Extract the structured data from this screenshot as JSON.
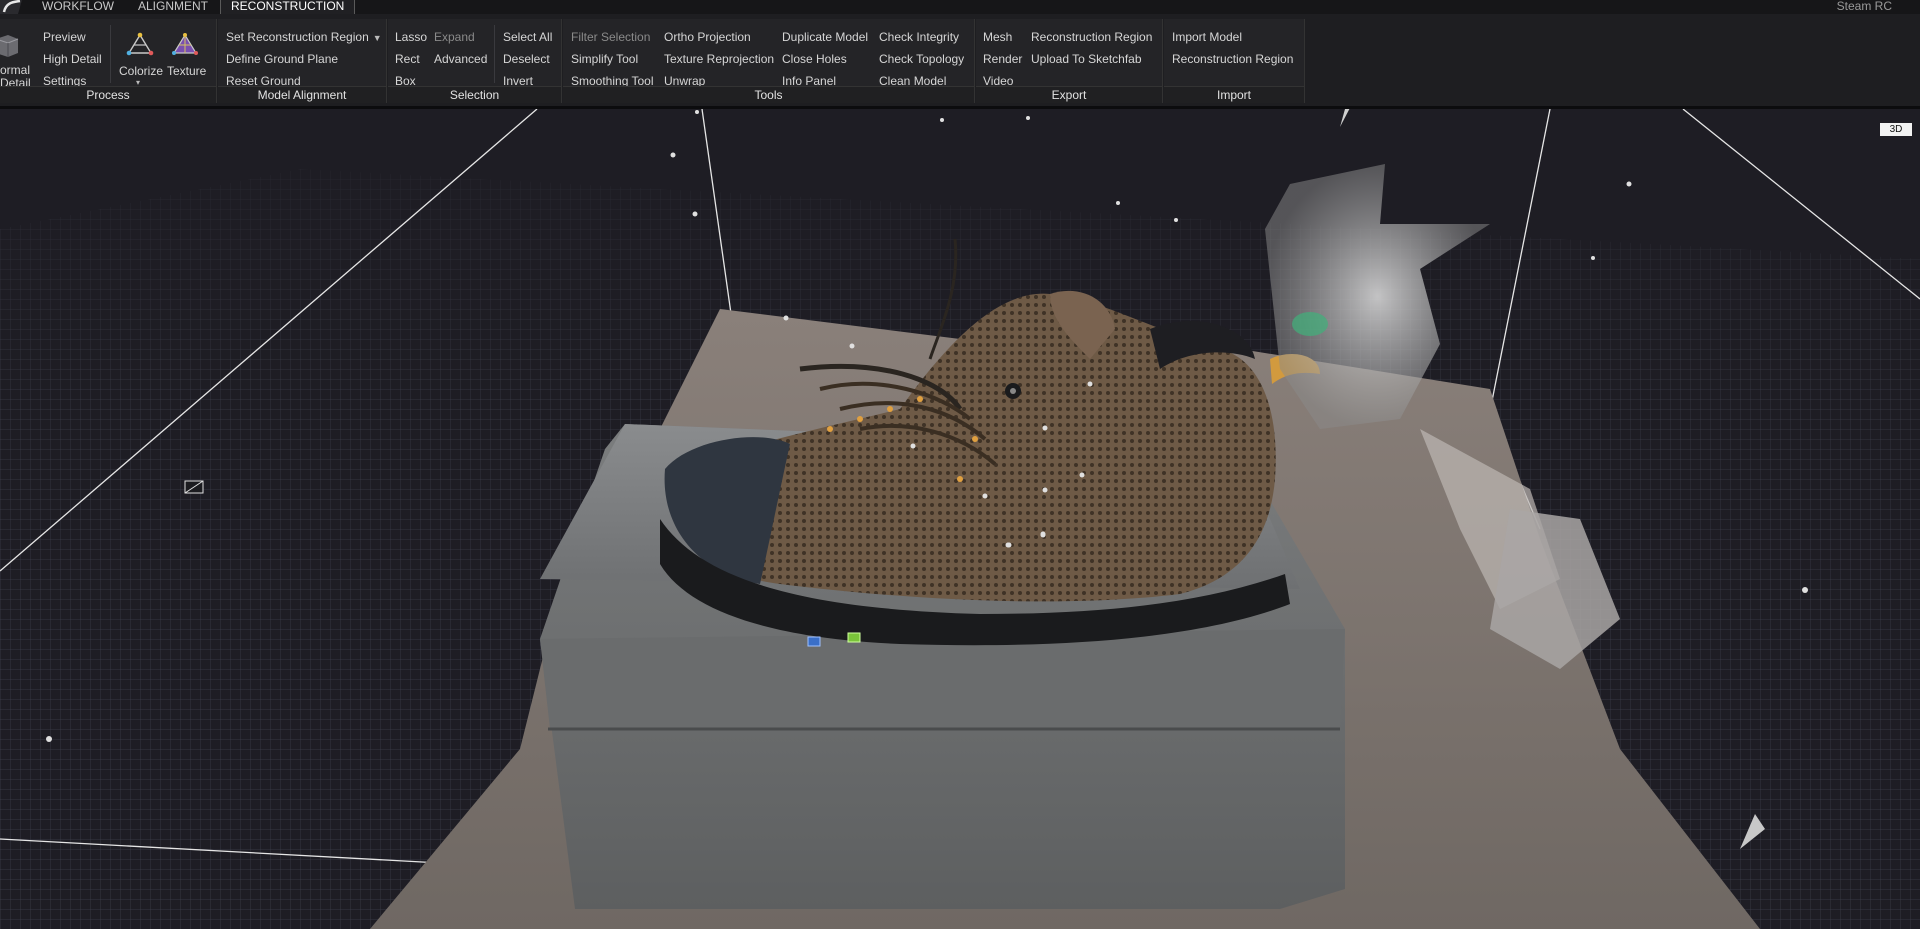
{
  "tabs": [
    {
      "label": "WORKFLOW"
    },
    {
      "label": "ALIGNMENT"
    },
    {
      "label": "RECONSTRUCTION",
      "active": true
    }
  ],
  "brand": "Steam RC",
  "process": {
    "title": "Process",
    "normal_detail": [
      "ormal",
      "Detail"
    ],
    "preview": "Preview",
    "high_detail": "High Detail",
    "settings": "Settings",
    "colorize": "Colorize",
    "texture": "Texture"
  },
  "model_alignment": {
    "title": "Model Alignment",
    "set_region": "Set Reconstruction Region",
    "define_ground": "Define Ground Plane",
    "reset_ground": "Reset Ground"
  },
  "selection": {
    "title": "Selection",
    "lasso": "Lasso",
    "expand": "Expand",
    "rect": "Rect",
    "advanced": "Advanced",
    "box": "Box",
    "select_all": "Select All",
    "deselect": "Deselect",
    "invert": "Invert"
  },
  "tools": {
    "title": "Tools",
    "filter_selection": "Filter Selection",
    "simplify": "Simplify Tool",
    "smoothing": "Smoothing Tool",
    "ortho": "Ortho Projection",
    "texture_reprojection": "Texture Reprojection",
    "unwrap": "Unwrap",
    "duplicate": "Duplicate Model",
    "close_holes": "Close Holes",
    "info_panel": "Info Panel",
    "check_integrity": "Check Integrity",
    "check_topology": "Check Topology",
    "clean_model": "Clean Model"
  },
  "export": {
    "title": "Export",
    "mesh": "Mesh",
    "render": "Render",
    "video": "Video",
    "reconstruction_region": "Reconstruction Region",
    "upload_sketchfab": "Upload To Sketchfab"
  },
  "import": {
    "title": "Import",
    "import_model": "Import Model",
    "reconstruction_region": "Reconstruction Region"
  },
  "viewport": {
    "mode_badge": "3D"
  },
  "colors": {
    "background": "#1e1d24",
    "grid": "#3b3c4a",
    "box_lines": "#e6e6e6",
    "ribbon": "#242427"
  }
}
